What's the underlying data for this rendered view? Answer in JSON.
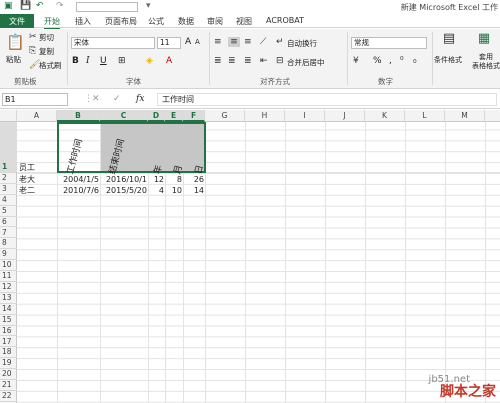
{
  "title": "新建 Microsoft Excel 工作",
  "tabs": [
    "文件",
    "开始",
    "插入",
    "页面布局",
    "公式",
    "数据",
    "审阅",
    "视图",
    "ACROBAT"
  ],
  "clipboard": {
    "paste": "粘贴",
    "cut": "剪切",
    "copy": "复制",
    "format_painter": "格式刷",
    "label": "剪贴板"
  },
  "font": {
    "name": "宋体",
    "size": "11",
    "label": "字体",
    "bold": "B",
    "italic": "I",
    "underline": "U",
    "grow": "A",
    "shrink": "A"
  },
  "alignment": {
    "wrap": "自动换行",
    "merge": "合并后居中",
    "label": "对齐方式"
  },
  "number": {
    "format": "常规",
    "label": "数字",
    "percent": "%",
    "comma": ","
  },
  "styles": {
    "conditional": "条件格式",
    "table": "套用\n表格格式"
  },
  "formula_bar": {
    "name_box": "B1",
    "fx": "fx",
    "value": "工作时间"
  },
  "columns": [
    "A",
    "B",
    "C",
    "D",
    "E",
    "F",
    "G",
    "H",
    "I",
    "J",
    "K",
    "L",
    "M"
  ],
  "rows": [
    "1",
    "2",
    "3",
    "4",
    "5",
    "6",
    "7",
    "8",
    "9",
    "10",
    "11",
    "12",
    "13",
    "14",
    "15",
    "16",
    "17",
    "18",
    "19",
    "20",
    "21",
    "22",
    "23"
  ],
  "sheet": {
    "a1": "员工",
    "b1": "工作时间",
    "c1": "结束时间",
    "d1": "年",
    "e1": "月",
    "f1": "日",
    "a2": "老大",
    "b2": "2004/1/5",
    "c2": "2016/10/1",
    "d2": "12",
    "e2": "8",
    "f2": "26",
    "a3": "老二",
    "b3": "2010/7/6",
    "c3": "2015/5/20",
    "d3": "4",
    "e3": "10",
    "f3": "14"
  },
  "watermark": {
    "site": "jb51.net",
    "name": "脚本之家"
  }
}
